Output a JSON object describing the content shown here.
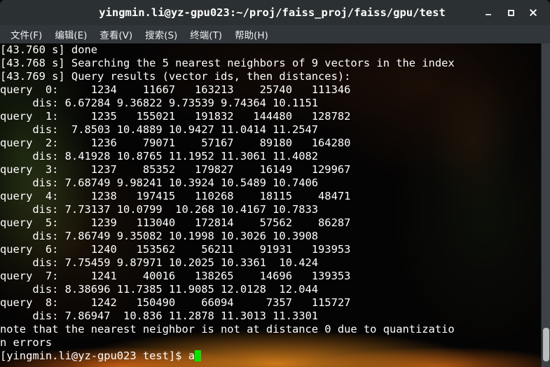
{
  "window": {
    "title": "yingmin.li@yz-gpu023:~/proj/faiss_proj/faiss/gpu/test",
    "controls": {
      "minimize": "_",
      "maximize": "□",
      "close": "✕"
    }
  },
  "menubar": {
    "items": [
      {
        "label": "文件(F)"
      },
      {
        "label": "编辑(E)"
      },
      {
        "label": "查看(V)"
      },
      {
        "label": "搜索(S)"
      },
      {
        "label": "终端(T)"
      },
      {
        "label": "帮助(H)"
      }
    ]
  },
  "terminal": {
    "columns": 69,
    "foreground_color": "#ffffff",
    "background_color": "#000000",
    "cursor_color": "#00e400",
    "cursor_char": "a",
    "lines": [
      "[43.760 s] done",
      "[43.768 s] Searching the 5 nearest neighbors of 9 vectors in the index",
      "[43.769 s] Query results (vector ids, then distances):",
      "query  0:     1234    11667   163213    25740   111346",
      "     dis: 6.67284 9.36822 9.73539 9.74364 10.1151",
      "query  1:     1235   155021   191832   144480   128782",
      "     dis:  7.8503 10.4889 10.9427 11.0414 11.2547",
      "query  2:     1236    79071    57167    89180   164280",
      "     dis: 8.41928 10.8765 11.1952 11.3061 11.4082",
      "query  3:     1237    85352   179827    16149   129967",
      "     dis: 7.68749 9.98241 10.3924 10.5489 10.7406",
      "query  4:     1238   197415   110268    18115    48471",
      "     dis: 7.73137 10.0799  10.268 10.4167 10.7833",
      "query  5:     1239   113040   172814    57562    86287",
      "     dis: 7.86749 9.35082 10.1998 10.3026 10.3908",
      "query  6:     1240   153562    56211    91931   193953",
      "     dis: 7.75459 9.87971 10.2025 10.3361  10.424",
      "query  7:     1241    40016   138265    14696   139353",
      "     dis: 8.38696 11.7385 11.9085 12.0128  12.044",
      "query  8:     1242   150490    66094     7357   115727",
      "     dis: 7.86947  10.836 11.2878 11.3013 11.3301",
      "note that the nearest neighbor is not at distance 0 due to quantizatio",
      "n errors"
    ],
    "prompt": "[yingmin.li@yz-gpu023 test]$ "
  },
  "scrollbar": {
    "thumb_label": "scroll-thumb"
  }
}
